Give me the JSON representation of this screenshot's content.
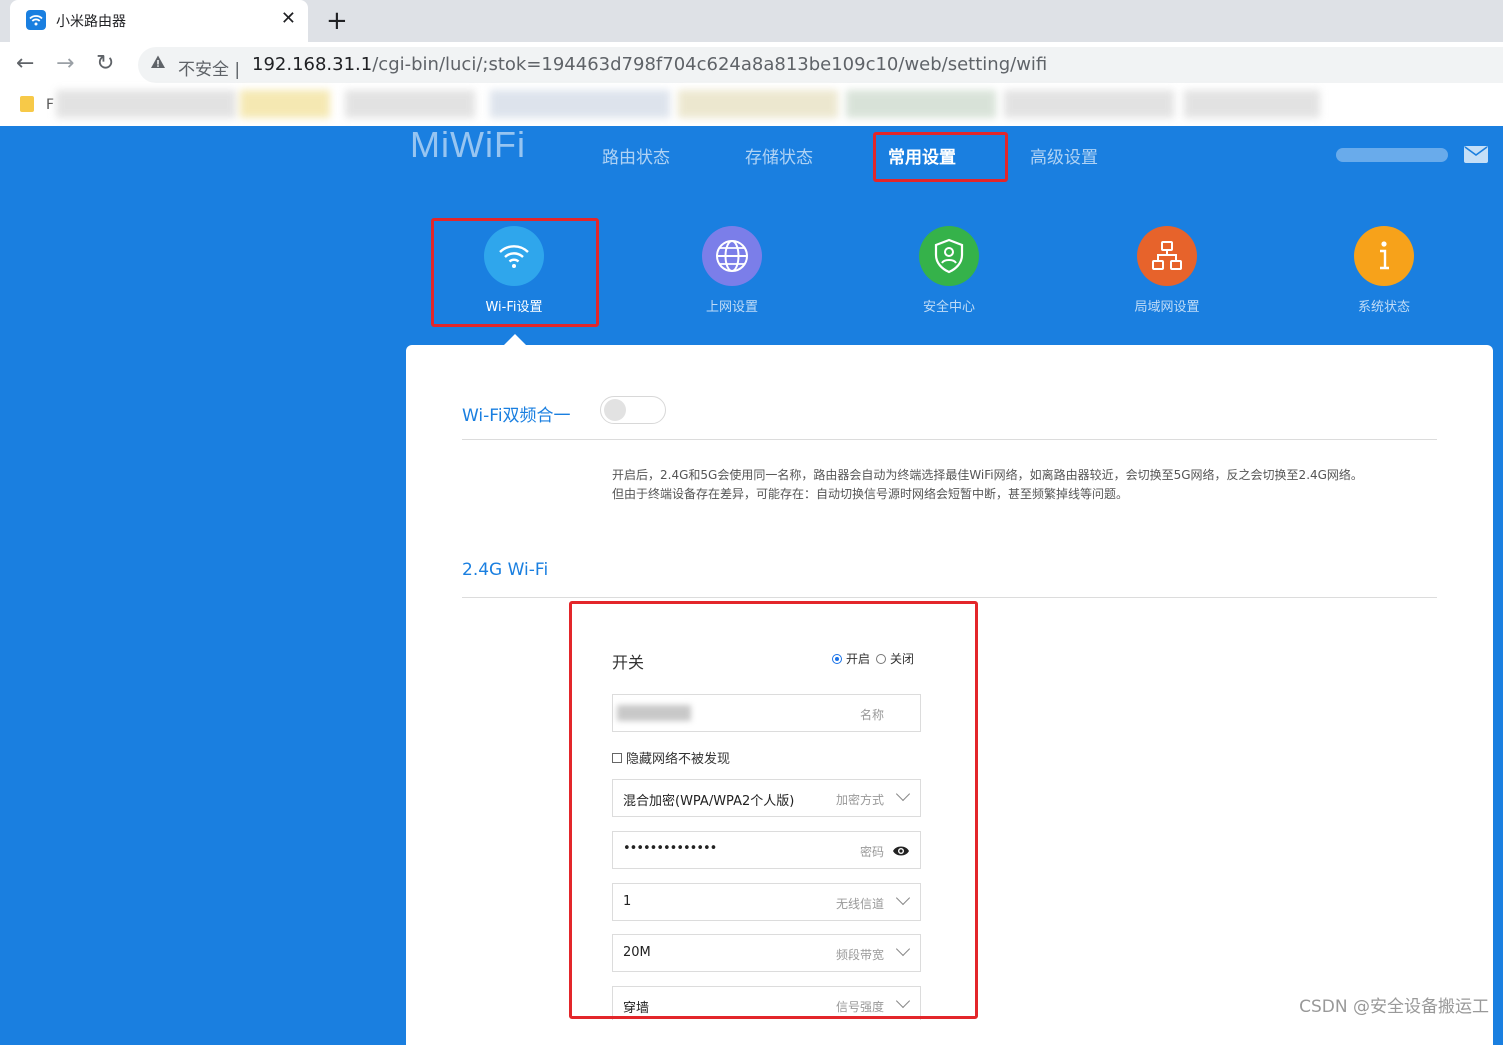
{
  "browser": {
    "tab_title": "小米路由器",
    "tab_close": "✕",
    "new_tab": "+",
    "back": "←",
    "forward": "→",
    "reload": "↻",
    "not_secure": "不安全 |",
    "url_host": "192.168.31.1",
    "url_path": "/cgi-bin/luci/;stok=194463d798f704c624a8a813be109c10/web/setting/wifi",
    "bookmark_letter": "F"
  },
  "header": {
    "logo": "MiWiFi",
    "nav": [
      "路由状态",
      "存储状态",
      "常用设置",
      "高级设置"
    ],
    "active_nav": "常用设置"
  },
  "categories": [
    {
      "label": "Wi-Fi设置",
      "color": "#2fa6ec"
    },
    {
      "label": "上网设置",
      "color": "#7b7ee9"
    },
    {
      "label": "安全中心",
      "color": "#35b24a"
    },
    {
      "label": "局域网设置",
      "color": "#e7632b"
    },
    {
      "label": "系统状态",
      "color": "#f7a21a"
    }
  ],
  "dual_band": {
    "title": "Wi-Fi双频合一",
    "enabled": false,
    "description_1": "开启后，2.4G和5G会使用同一名称，路由器会自动为终端选择最佳WiFi网络，如离路由器较近，会切换至5G网络，反之会切换至2.4G网络。",
    "description_2": "但由于终端设备存在差异，可能存在：自动切换信号源时网络会短暂中断，甚至频繁掉线等问题。"
  },
  "wifi24": {
    "title": "2.4G Wi-Fi",
    "switch_label": "开关",
    "on_label": "开启",
    "off_label": "关闭",
    "name_hint": "名称",
    "hide_label": "隐藏网络不被发现",
    "encryption_value": "混合加密(WPA/WPA2个人版)",
    "encryption_hint": "加密方式",
    "password_value": "••••••••••••••",
    "password_hint": "密码",
    "channel_value": "1",
    "channel_hint": "无线信道",
    "bandwidth_value": "20M",
    "bandwidth_hint": "频段带宽",
    "signal_value": "穿墙",
    "signal_hint": "信号强度"
  },
  "watermark": "CSDN @安全设备搬运工"
}
